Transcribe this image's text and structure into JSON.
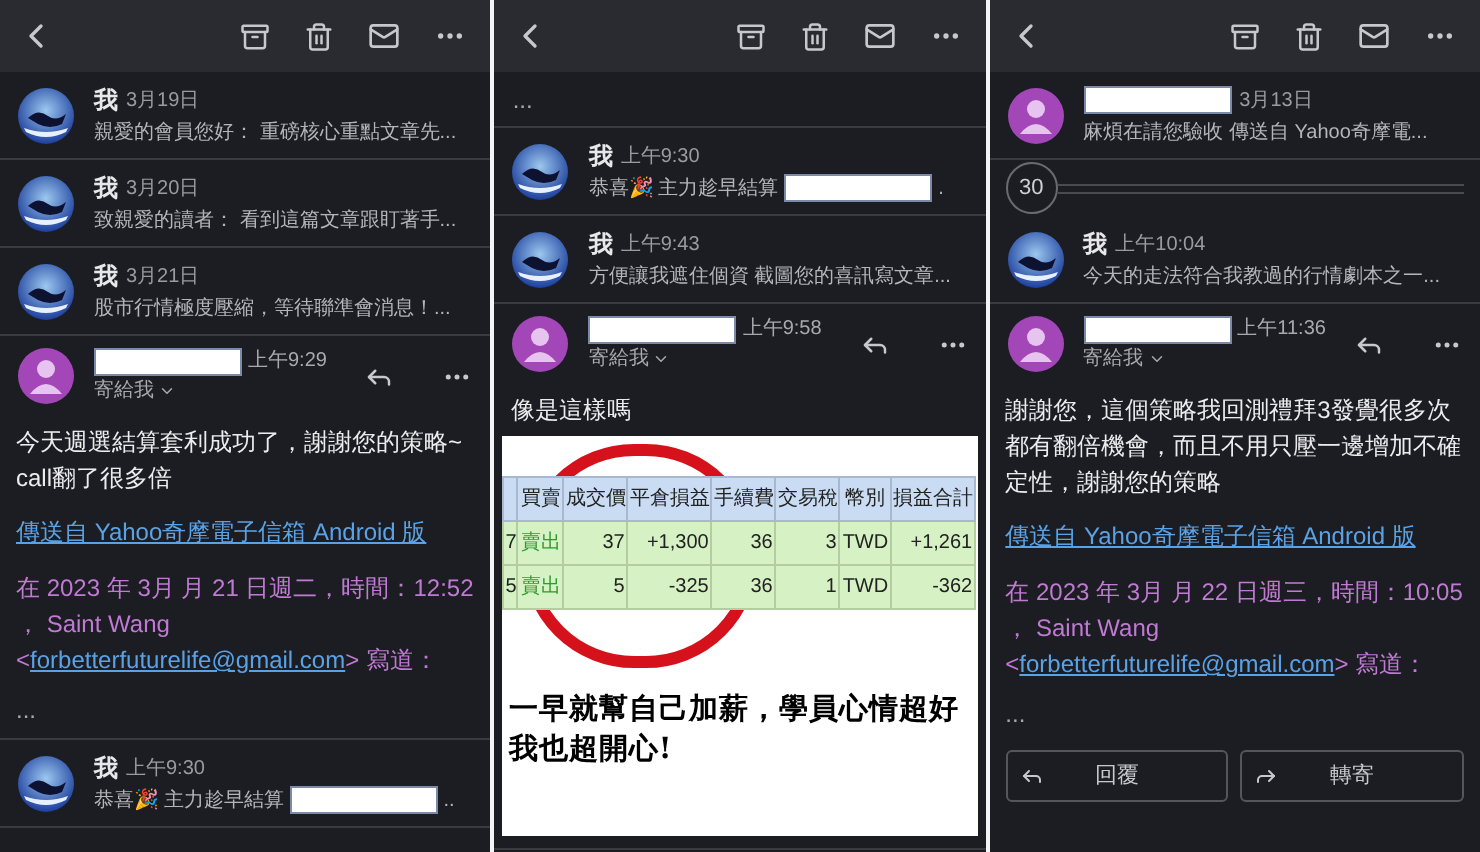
{
  "panels": [
    {
      "items": [
        {
          "kind": "collapsed",
          "sender": "我",
          "date": "3月19日",
          "snippet": "親愛的會員您好：  重磅核心重點文章先..."
        },
        {
          "kind": "collapsed",
          "sender": "我",
          "date": "3月20日",
          "snippet": "致親愛的讀者：  看到這篇文章跟盯著手..."
        },
        {
          "kind": "collapsed",
          "sender": "我",
          "date": "3月21日",
          "snippet": "股市行情極度壓縮，等待聯準會消息！..."
        },
        {
          "kind": "expanded",
          "sender_redacted": true,
          "time": "上午9:29",
          "recipient": "寄給我",
          "body": "今天週選結算套利成功了，謝謝您的策略~ call翻了很多倍",
          "link": "傳送自 Yahoo奇摩電子信箱 Android 版",
          "quote_prefix": "在 2023 年 3月 月 21 日週二，時間：12:52 ， Saint Wang <",
          "quote_email": "forbetterfuturelife@gmail.com",
          "quote_suffix": "> 寫道：",
          "trailer": "..."
        },
        {
          "kind": "collapsed",
          "sender": "我",
          "date": "上午9:30",
          "snippet": "恭喜🎉 主力趁早結算",
          "snippet_redacted": true,
          "snippet_end": ".."
        }
      ]
    },
    {
      "items": [
        {
          "kind": "ellipsis",
          "text": "..."
        },
        {
          "kind": "collapsed",
          "sender": "我",
          "date": "上午9:30",
          "snippet": "恭喜🎉 主力趁早結算",
          "snippet_redacted": true,
          "snippet_end": "."
        },
        {
          "kind": "collapsed",
          "sender": "我",
          "date": "上午9:43",
          "snippet": "方便讓我遮住個資 截圖您的喜訊寫文章..."
        },
        {
          "kind": "expanded",
          "sender_redacted": true,
          "time": "上午9:58",
          "recipient": "寄給我",
          "body": "像是這樣嗎",
          "attachment": {
            "columns": [
              "買賣",
              "成交價",
              "平倉損益",
              "手續費",
              "交易稅",
              "幣別",
              "損益合計"
            ],
            "rows": [
              {
                "index": "7",
                "cells": [
                  "賣出",
                  "37",
                  "+1,300",
                  "36",
                  "3",
                  "TWD",
                  "+1,261"
                ]
              },
              {
                "index": "5",
                "cells": [
                  "賣出",
                  "5",
                  "-325",
                  "36",
                  "1",
                  "TWD",
                  "-362"
                ]
              }
            ],
            "caption": [
              "一早就幫自己加薪，學員心情超好",
              "我也超開心!"
            ]
          }
        }
      ]
    },
    {
      "items": [
        {
          "kind": "collapsed",
          "sender_redacted": true,
          "date": "3月13日",
          "snippet": "麻煩在請您驗收 傳送自 Yahoo奇摩電..."
        },
        {
          "kind": "counter",
          "count": "30"
        },
        {
          "kind": "collapsed",
          "sender": "我",
          "date": "上午10:04",
          "snippet": "今天的走法符合我教過的行情劇本之一..."
        },
        {
          "kind": "expanded",
          "sender_redacted": true,
          "time": "上午11:36",
          "recipient": "寄給我",
          "body": "謝謝您，這個策略我回測禮拜3發覺很多次都有翻倍機會，而且不用只壓一邊增加不確定性，謝謝您的策略",
          "link": "傳送自 Yahoo奇摩電子信箱 Android 版",
          "quote_prefix": "在 2023 年 3月 月 22 日週三，時間：10:05 ， Saint Wang <",
          "quote_email": "forbetterfuturelife@gmail.com",
          "quote_suffix": "> 寫道：",
          "trailer": "...",
          "buttons": [
            {
              "kind": "reply",
              "label": "回覆"
            },
            {
              "kind": "forward",
              "label": "轉寄"
            }
          ]
        }
      ]
    }
  ]
}
